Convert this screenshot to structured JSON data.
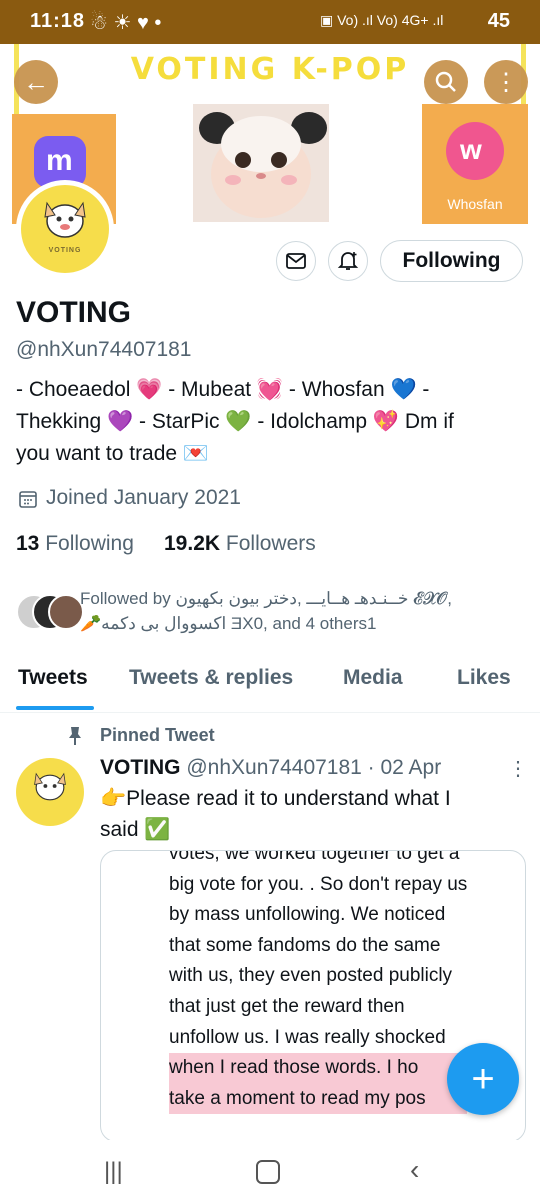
{
  "status_bar": {
    "time": "11:18",
    "battery": "45"
  },
  "banner": {
    "title": "VOTING K-POP",
    "right_tile_label": "Whosfan"
  },
  "avatar": {
    "label": "VOTING"
  },
  "profile": {
    "following_button": "Following",
    "name": "VOTING",
    "handle": "@nhXun74407181",
    "bio_line1": "- Choeaedol 💗 - Mubeat 💓 - Whosfan 💙 -",
    "bio_line2": "Thekking 💜 - StarPic 💚 - Idolchamp 💖  Dm if",
    "bio_line3": "you want to trade 💌",
    "joined": "Joined January 2021",
    "following_count": "13",
    "following_label": "Following",
    "followers_count": "19.2K",
    "followers_label": "Followers",
    "followed_by_line1": "Followed by خــنـدهـ هــايـــ ,دختر بیون بکهیون 𝓔𝓧𝓞,",
    "followed_by_line2": "🥕اکسووال بی دکمه ƎX0, and 4 others1"
  },
  "tabs": [
    "Tweets",
    "Tweets & replies",
    "Media",
    "Likes"
  ],
  "pinned_tweet": {
    "pinned_label": "Pinned Tweet",
    "author_name": "VOTING",
    "author_meta": "@nhXun74407181 · 02 Apr",
    "text_line1": "👉Please read it to understand what I",
    "text_line2": "said ✅",
    "image_lines": [
      "votes, we worked together to get a",
      "big vote for you. . So don't repay us",
      "by mass unfollowing. We noticed",
      "that some fandoms do the same",
      "with us, they even posted publicly",
      "that just get the reward then",
      "unfollow us. I was really shocked",
      "when I read those words. I ho",
      "take a moment to read my pos"
    ]
  },
  "colors": {
    "status_bar": "#8a5a10",
    "banner_title": "#f5dd3c",
    "tile": "#f3ac4e",
    "accent": "#1d9bf0"
  }
}
